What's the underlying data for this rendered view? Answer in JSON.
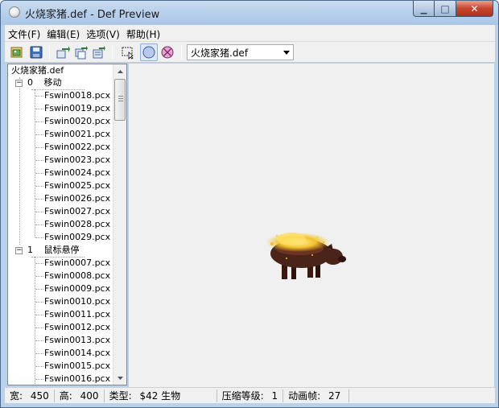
{
  "window": {
    "title": "火烧家猪.def - Def Preview",
    "minimize_glyph": "▁",
    "maximize_glyph": "□",
    "close_glyph": "✕"
  },
  "menu": [
    {
      "label": "文件(F)"
    },
    {
      "label": "编辑(E)"
    },
    {
      "label": "选项(V)"
    },
    {
      "label": "帮助(H)"
    }
  ],
  "toolbar": {
    "buttons": [
      "open-icon",
      "save-icon",
      "export-icon",
      "export-all-icon",
      "export-frames-icon",
      "select-area-icon",
      "background-color-icon",
      "transparent-color-icon"
    ],
    "combo_value": "火烧家猪.def"
  },
  "tree": {
    "root": "火烧家猪.def",
    "groups": [
      {
        "index": "0",
        "name": "移动",
        "files": [
          "Fswin0018.pcx",
          "Fswin0019.pcx",
          "Fswin0020.pcx",
          "Fswin0021.pcx",
          "Fswin0022.pcx",
          "Fswin0023.pcx",
          "Fswin0024.pcx",
          "Fswin0025.pcx",
          "Fswin0026.pcx",
          "Fswin0027.pcx",
          "Fswin0028.pcx",
          "Fswin0029.pcx"
        ]
      },
      {
        "index": "1",
        "name": "鼠标悬停",
        "files": [
          "Fswin0007.pcx",
          "Fswin0008.pcx",
          "Fswin0009.pcx",
          "Fswin0010.pcx",
          "Fswin0011.pcx",
          "Fswin0012.pcx",
          "Fswin0013.pcx",
          "Fswin0014.pcx",
          "Fswin0015.pcx",
          "Fswin0016.pcx"
        ]
      }
    ]
  },
  "status": {
    "width_label": "宽:",
    "width_value": "450",
    "height_label": "高:",
    "height_value": "400",
    "type_label": "类型:",
    "type_value": "$42 生物",
    "compression_label": "压缩等级:",
    "compression_value": "1",
    "frames_label": "动画帧:",
    "frames_value": "27"
  },
  "colors": {
    "titlebar": "#b9d1ea",
    "panel_bg": "#f0f0f0",
    "close_button": "#c7452c",
    "pig_body": "#4a2418",
    "fire_glow": "#f3c22a"
  }
}
